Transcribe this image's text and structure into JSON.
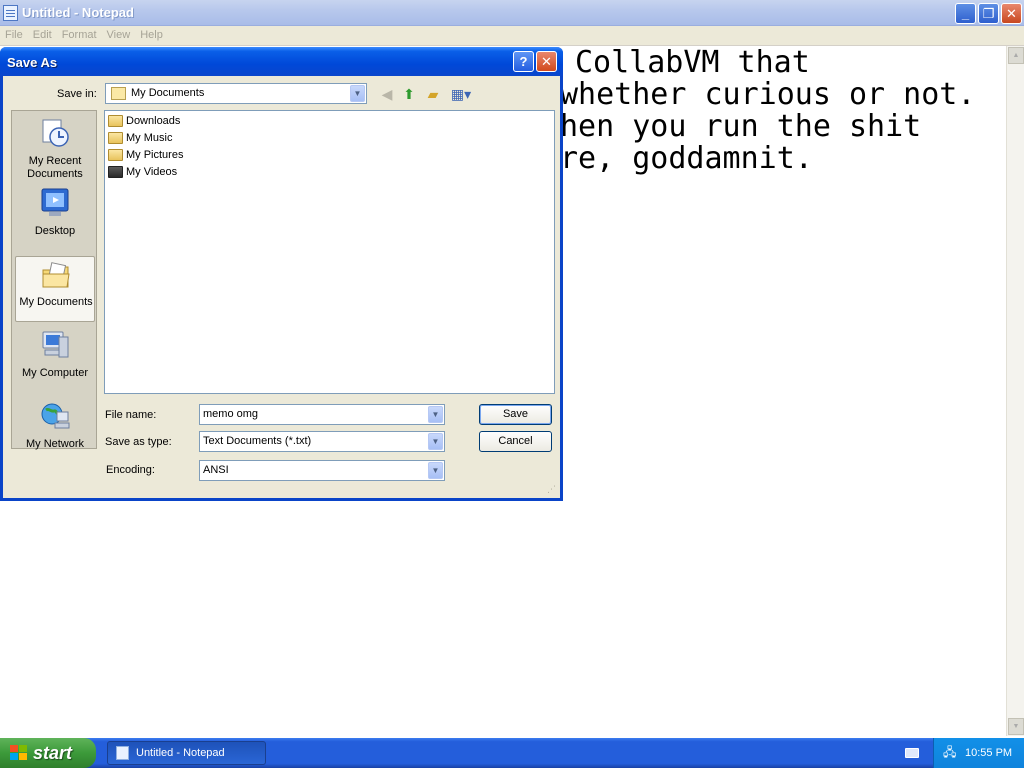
{
  "notepad": {
    "title": "Untitled - Notepad",
    "menu": [
      "File",
      "Edit",
      "Format",
      "View",
      "Help"
    ],
    "text_lines": [
      "CollabVM that",
      "whether curious or not.",
      "hen you run the shit",
      "re, goddamnit."
    ]
  },
  "dialog": {
    "title": "Save As",
    "save_in_label": "Save in:",
    "save_in_value": "My Documents",
    "places": [
      "My Recent Documents",
      "Desktop",
      "My Documents",
      "My Computer",
      "My Network"
    ],
    "files": [
      "Downloads",
      "My Music",
      "My Pictures",
      "My Videos"
    ],
    "file_name_label": "File name:",
    "file_name_value": "memo omg",
    "save_type_label": "Save as type:",
    "save_type_value": "Text Documents (*.txt)",
    "encoding_label": "Encoding:",
    "encoding_value": "ANSI",
    "save_button": "Save",
    "cancel_button": "Cancel"
  },
  "taskbar": {
    "start_label": "start",
    "task_label": "Untitled - Notepad",
    "clock": "10:55 PM"
  },
  "colors": {
    "dialog_title": "#0a46cc",
    "dialog_face": "#ece9d8",
    "taskbar": "#245edb",
    "start": "#3c9a3a"
  }
}
